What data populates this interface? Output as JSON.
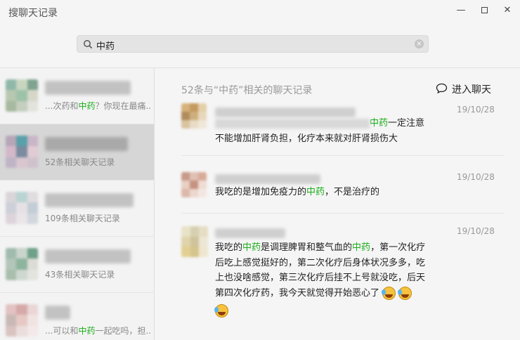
{
  "window": {
    "title": "搜聊天记录",
    "controls": {
      "minimize": "—",
      "maximize": "",
      "close": "✕"
    }
  },
  "search": {
    "value": "中药",
    "clear": "×"
  },
  "sidebar": {
    "items": [
      {
        "subtitle_pre": "...次药和",
        "subtitle_hl": "中药",
        "subtitle_post": "？你现在最痛..."
      },
      {
        "subtitle_pre": "52条相关聊天记录",
        "subtitle_hl": "",
        "subtitle_post": ""
      },
      {
        "subtitle_pre": "109条相关聊天记录",
        "subtitle_hl": "",
        "subtitle_post": ""
      },
      {
        "subtitle_pre": "43条相关聊天记录",
        "subtitle_hl": "",
        "subtitle_post": ""
      },
      {
        "subtitle_pre": "...可以和",
        "subtitle_hl": "中药",
        "subtitle_post": "一起吃吗，担..."
      }
    ]
  },
  "content": {
    "result_count": "52条与“中药”相关的聊天记录",
    "enter_chat_label": "进入聊天",
    "messages": [
      {
        "date": "19/10/28",
        "line1_hl": "中药",
        "line1_post": "一定注意",
        "line2": "不能增加肝肾负担，化疗本来就对肝肾损伤大"
      },
      {
        "date": "19/10/28",
        "pre": "我吃的是增加免疫力的",
        "hl": "中药",
        "post": "，不是治疗的"
      },
      {
        "date": "19/10/28",
        "l1a": "我吃的",
        "l1hl1": "中药",
        "l1b": "是调理脾胃和整气血的",
        "l1hl2": "中药",
        "l1c": "，第一次化疗",
        "l2": "后吃上感觉挺好的，第二次化疗后身体状况多多，吃",
        "l3": "上也没啥感觉，第三次化疗后挂不上号就没吃，后天",
        "l4": "第四次化疗药，我今天就觉得开始恶心了"
      }
    ]
  },
  "colors": {
    "highlight": "#1aad19",
    "selected_bg": "#d6d6d6"
  },
  "icons": [
    "search-icon",
    "clear-icon",
    "chat-bubble-icon",
    "emoji-laugh-cry-icon"
  ]
}
